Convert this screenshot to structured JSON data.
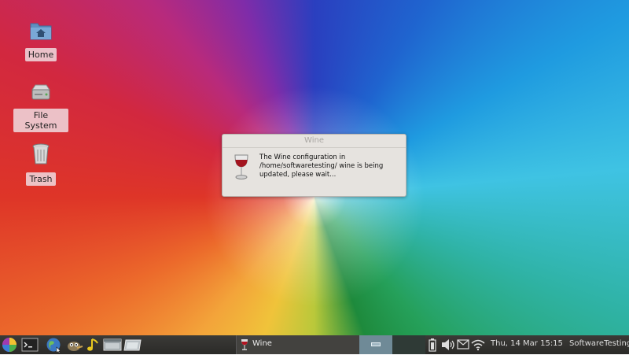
{
  "desktop": {
    "icons": [
      {
        "label": "Home"
      },
      {
        "label": "File System"
      },
      {
        "label": "Trash"
      }
    ]
  },
  "dialog": {
    "title": "Wine",
    "message": "The Wine configuration in /home/softwaretesting/ wine is being updated, please wait..."
  },
  "taskbar": {
    "launchers": [
      "app-menu-icon",
      "terminal-icon",
      "web-browser-icon",
      "gimp-icon",
      "music-player-icon",
      "file-manager-icon",
      "window-icon"
    ],
    "task": {
      "label": "Wine"
    },
    "tray": [
      "battery-icon",
      "volume-icon",
      "mail-icon",
      "wifi-icon"
    ],
    "clock": "Thu, 14 Mar  15:15",
    "user": "SoftwareTesting"
  },
  "colors": {
    "taskbar_bg": "#33322f",
    "dialog_bg": "#e6e3df",
    "active_workspace": "#6f8a97"
  }
}
